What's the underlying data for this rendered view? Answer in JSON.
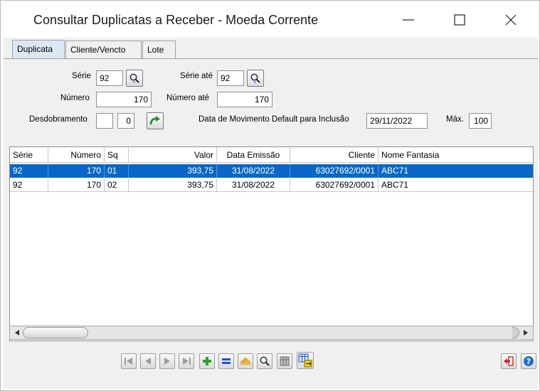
{
  "window": {
    "title": "Consultar Duplicatas a Receber - Moeda Corrente"
  },
  "tabs": [
    {
      "label": "Duplicata",
      "active": true
    },
    {
      "label": "Cliente/Vencto",
      "active": false
    },
    {
      "label": "Lote",
      "active": false
    }
  ],
  "form": {
    "serie_label": "Série",
    "serie_value": "92",
    "serie_ate_label": "Série até",
    "serie_ate_value": "92",
    "numero_label": "Número",
    "numero_value": "170",
    "numero_ate_label": "Número até",
    "numero_ate_value": "170",
    "desdobramento_label": "Desdobramento",
    "desdobramento_value1": "",
    "desdobramento_value2": "0",
    "data_mov_label": "Data de Movimento Default para Inclusão",
    "data_mov_value": "29/11/2022",
    "max_label": "Máx.",
    "max_value": "100"
  },
  "grid": {
    "columns": [
      "Série",
      "Número",
      "Sq",
      "Valor",
      "Data Emissão",
      "Cliente",
      "Nome Fantasia"
    ],
    "rows": [
      {
        "serie": "92",
        "numero": "170",
        "sq": "01",
        "valor": "393,75",
        "data": "31/08/2022",
        "cliente": "63027692/0001",
        "fantasia": "ABC71",
        "selected": true
      },
      {
        "serie": "92",
        "numero": "170",
        "sq": "02",
        "valor": "393,75",
        "data": "31/08/2022",
        "cliente": "63027692/0001",
        "fantasia": "ABC71",
        "selected": false
      }
    ]
  },
  "toolbar": {
    "icons": [
      "first-record-icon",
      "prev-record-icon",
      "next-record-icon",
      "last-record-icon",
      "add-icon",
      "equals-icon",
      "eject-icon",
      "search-icon",
      "grid-view-icon",
      "export-icon"
    ],
    "exit_icon": "exit-icon",
    "help_icon": "help-icon"
  },
  "colors": {
    "selection": "#0a67c8",
    "add_green": "#2ea12e",
    "equals_blue": "#1f4fd6",
    "exit_red": "#c0282d",
    "help_blue": "#1f6fd0"
  }
}
